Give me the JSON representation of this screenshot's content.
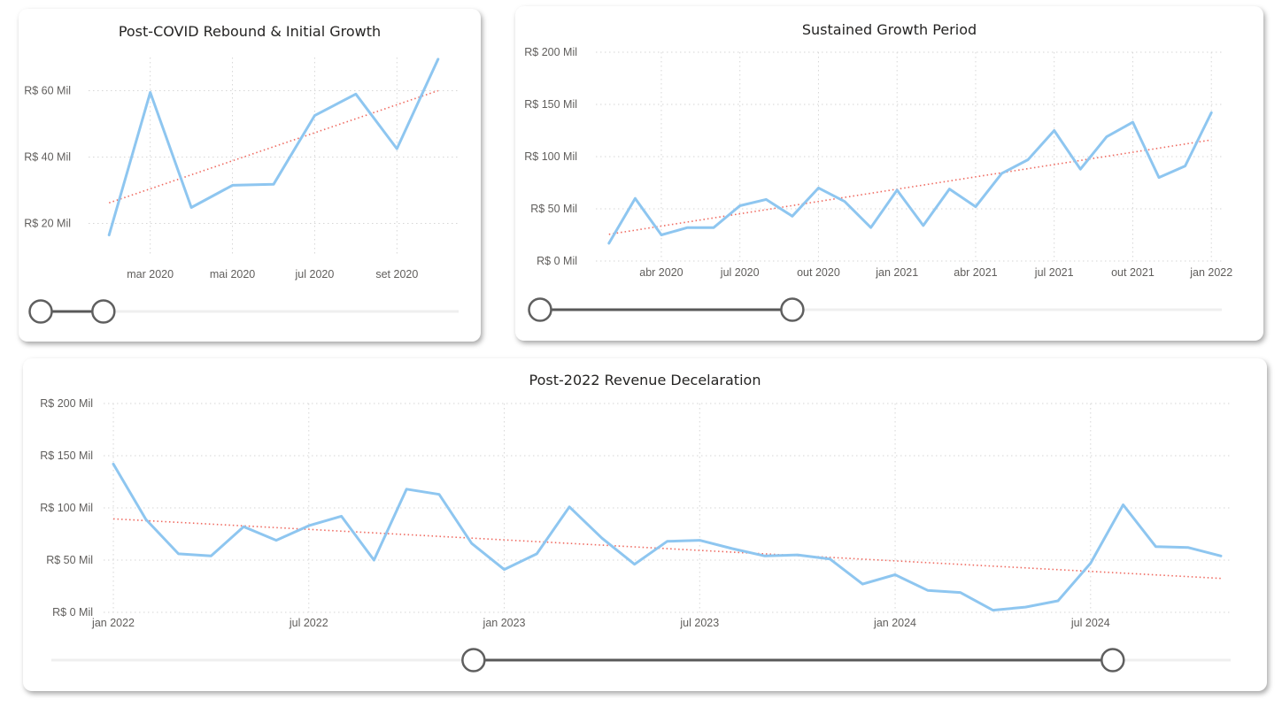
{
  "chart_data": [
    {
      "type": "line",
      "title": "Post-COVID Rebound & Initial Growth",
      "y_ticks": [
        "R$ 20 Mil",
        "R$ 40 Mil",
        "R$ 60 Mil"
      ],
      "y_tick_values": [
        20,
        40,
        60
      ],
      "ylim": [
        10,
        70
      ],
      "x_ticks": [
        "mar 2020",
        "mai 2020",
        "jul 2020",
        "set 2020"
      ],
      "x_tick_values": [
        2,
        4,
        6,
        8
      ],
      "xlim": [
        0.5,
        9.5
      ],
      "x": [
        1,
        2,
        3,
        4,
        5,
        6,
        7,
        8,
        9
      ],
      "values": [
        16.5,
        59.5,
        24.8,
        31.5,
        31.8,
        52.5,
        59,
        42.5,
        69.5
      ],
      "trend": [
        26.2,
        60
      ],
      "grid": true,
      "legend": "none",
      "colors": {
        "series": "#8ec6f0",
        "trend": "#ef6a60"
      },
      "slider_range": [
        0,
        0.15
      ]
    },
    {
      "type": "line",
      "title": "Sustained Growth Period",
      "y_ticks": [
        "R$ 0 Mil",
        "R$ 50 Mil",
        "R$ 100 Mil",
        "R$ 150 Mil",
        "R$ 200 Mil"
      ],
      "y_tick_values": [
        0,
        50,
        100,
        150,
        200
      ],
      "ylim": [
        0,
        200
      ],
      "x_ticks": [
        "abr 2020",
        "jul 2020",
        "out 2020",
        "jan 2021",
        "abr 2021",
        "jul 2021",
        "out 2021",
        "jan 2022"
      ],
      "x_tick_values": [
        3,
        6,
        9,
        12,
        15,
        18,
        21,
        24
      ],
      "xlim": [
        0.5,
        24.5
      ],
      "x": [
        1,
        2,
        3,
        4,
        5,
        6,
        7,
        8,
        9,
        10,
        11,
        12,
        13,
        14,
        15,
        16,
        17,
        18,
        19,
        20,
        21,
        22,
        23,
        24
      ],
      "values": [
        17,
        60,
        25,
        32,
        32,
        53,
        59,
        43,
        70,
        57,
        32,
        68,
        34,
        69,
        52,
        84,
        97,
        125,
        88,
        119,
        133,
        80,
        91,
        142
      ],
      "trend": [
        25.6,
        116
      ],
      "grid": true,
      "legend": "none",
      "colors": {
        "series": "#8ec6f0",
        "trend": "#ef6a60"
      },
      "slider_range": [
        0,
        0.37
      ]
    },
    {
      "type": "line",
      "title": "Post-2022 Revenue Decelaration",
      "y_ticks": [
        "R$ 0 Mil",
        "R$ 50 Mil",
        "R$ 100 Mil",
        "R$ 150 Mil",
        "R$ 200 Mil"
      ],
      "y_tick_values": [
        0,
        50,
        100,
        150,
        200
      ],
      "ylim": [
        0,
        200
      ],
      "x_ticks": [
        "jan 2022",
        "jul 2022",
        "jan 2023",
        "jul 2023",
        "jan 2024",
        "jul 2024"
      ],
      "x_tick_values": [
        0,
        6,
        12,
        18,
        24,
        30
      ],
      "xlim": [
        -0.3,
        34.3
      ],
      "x": [
        0,
        1,
        2,
        3,
        4,
        5,
        6,
        7,
        8,
        9,
        10,
        11,
        12,
        13,
        14,
        15,
        16,
        17,
        18,
        19,
        20,
        21,
        22,
        23,
        24,
        25,
        26,
        27,
        28,
        29,
        30,
        31,
        32,
        33,
        34
      ],
      "values": [
        142,
        89,
        56,
        54,
        82,
        69,
        83,
        92,
        50,
        118,
        113,
        66,
        41,
        56,
        101,
        71,
        46,
        68,
        69,
        61,
        54,
        55,
        51,
        27,
        36,
        21,
        19,
        2,
        5,
        11,
        47,
        103,
        63,
        62,
        54
      ],
      "trend": [
        89.5,
        32.5
      ],
      "grid": true,
      "legend": "none",
      "colors": {
        "series": "#8ec6f0",
        "trend": "#ef6a60"
      },
      "slider_range": [
        0.358,
        0.9
      ]
    }
  ]
}
